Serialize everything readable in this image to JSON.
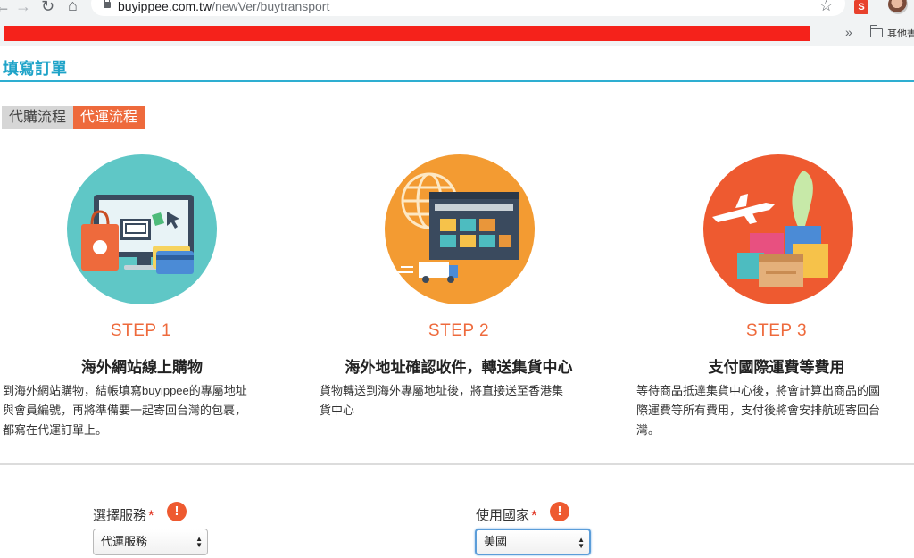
{
  "browser": {
    "url_domain": "buyippee.com.tw",
    "url_path": "/newVer/buytransport",
    "extension_label": "S",
    "bookmarks_more": "»",
    "bookmarks_other": "其他書"
  },
  "page": {
    "title": "填寫訂單"
  },
  "tabs": [
    {
      "label": "代購流程"
    },
    {
      "label": "代運流程"
    }
  ],
  "steps": [
    {
      "label": "STEP 1",
      "heading": "海外網站線上購物",
      "desc_lines": [
        "到海外網站購物，結帳填寫buyippee的專屬地址",
        "與會員編號，再將準備要一起寄回台灣的包裹，",
        "都寫在代運訂單上。"
      ]
    },
    {
      "label": "STEP 2",
      "heading": "海外地址確認收件，轉送集貨中心",
      "desc_lines": [
        "貨物轉送到海外專屬地址後，將直接送至香港集",
        "貨中心"
      ]
    },
    {
      "label": "STEP 3",
      "heading": "支付國際運費等費用",
      "desc_lines": [
        "等待商品抵達集貨中心後，將會計算出商品的國",
        "際運費等所有費用，支付後將會安排航班寄回台",
        "灣。"
      ]
    }
  ],
  "form": {
    "service": {
      "label": "選擇服務",
      "required": "*",
      "warn": "!",
      "value": "代運服務"
    },
    "country": {
      "label": "使用國家",
      "required": "*",
      "warn": "!",
      "value": "美國"
    }
  },
  "colors": {
    "accent_blue": "#1ea3c8",
    "accent_orange": "#ee6a3c",
    "step1_bg": "#5fc7c6",
    "step2_bg": "#f39b32",
    "step3_bg": "#ee5a30"
  }
}
